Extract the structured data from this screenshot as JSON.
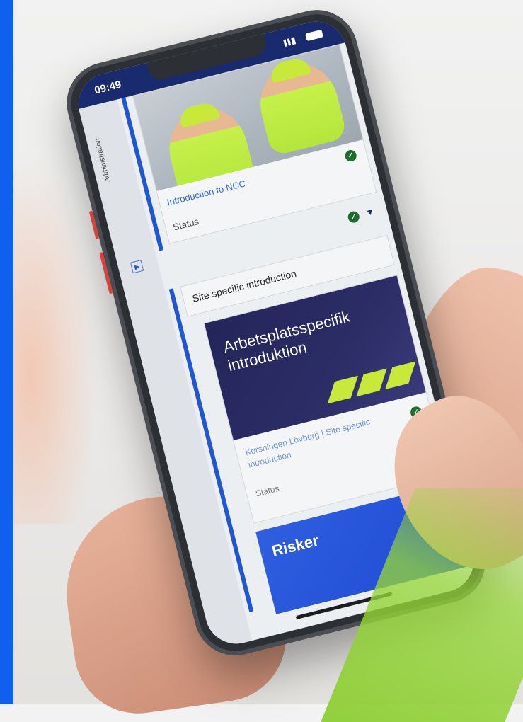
{
  "phone": {
    "status_time": "09:49",
    "side_rail_label": "Administration",
    "card1": {
      "title": "Introduction to NCC",
      "status": "Status"
    },
    "section2": {
      "title": "Site specific introduction"
    },
    "card2": {
      "banner_title": "Arbetsplatsspecifik introduktion",
      "title": "Korsningen Lövberg | Site specific introduction",
      "status": "Status"
    },
    "card3": {
      "banner_title": "Risker"
    }
  },
  "colors": {
    "accent_blue": "#1e57d0",
    "navy": "#23255a",
    "brand_green": "#c8e83a",
    "check_green": "#1d6b2f"
  },
  "icons": {
    "check": "check-circle-icon",
    "chevron": "chevron-down-icon",
    "play": "play-icon"
  }
}
